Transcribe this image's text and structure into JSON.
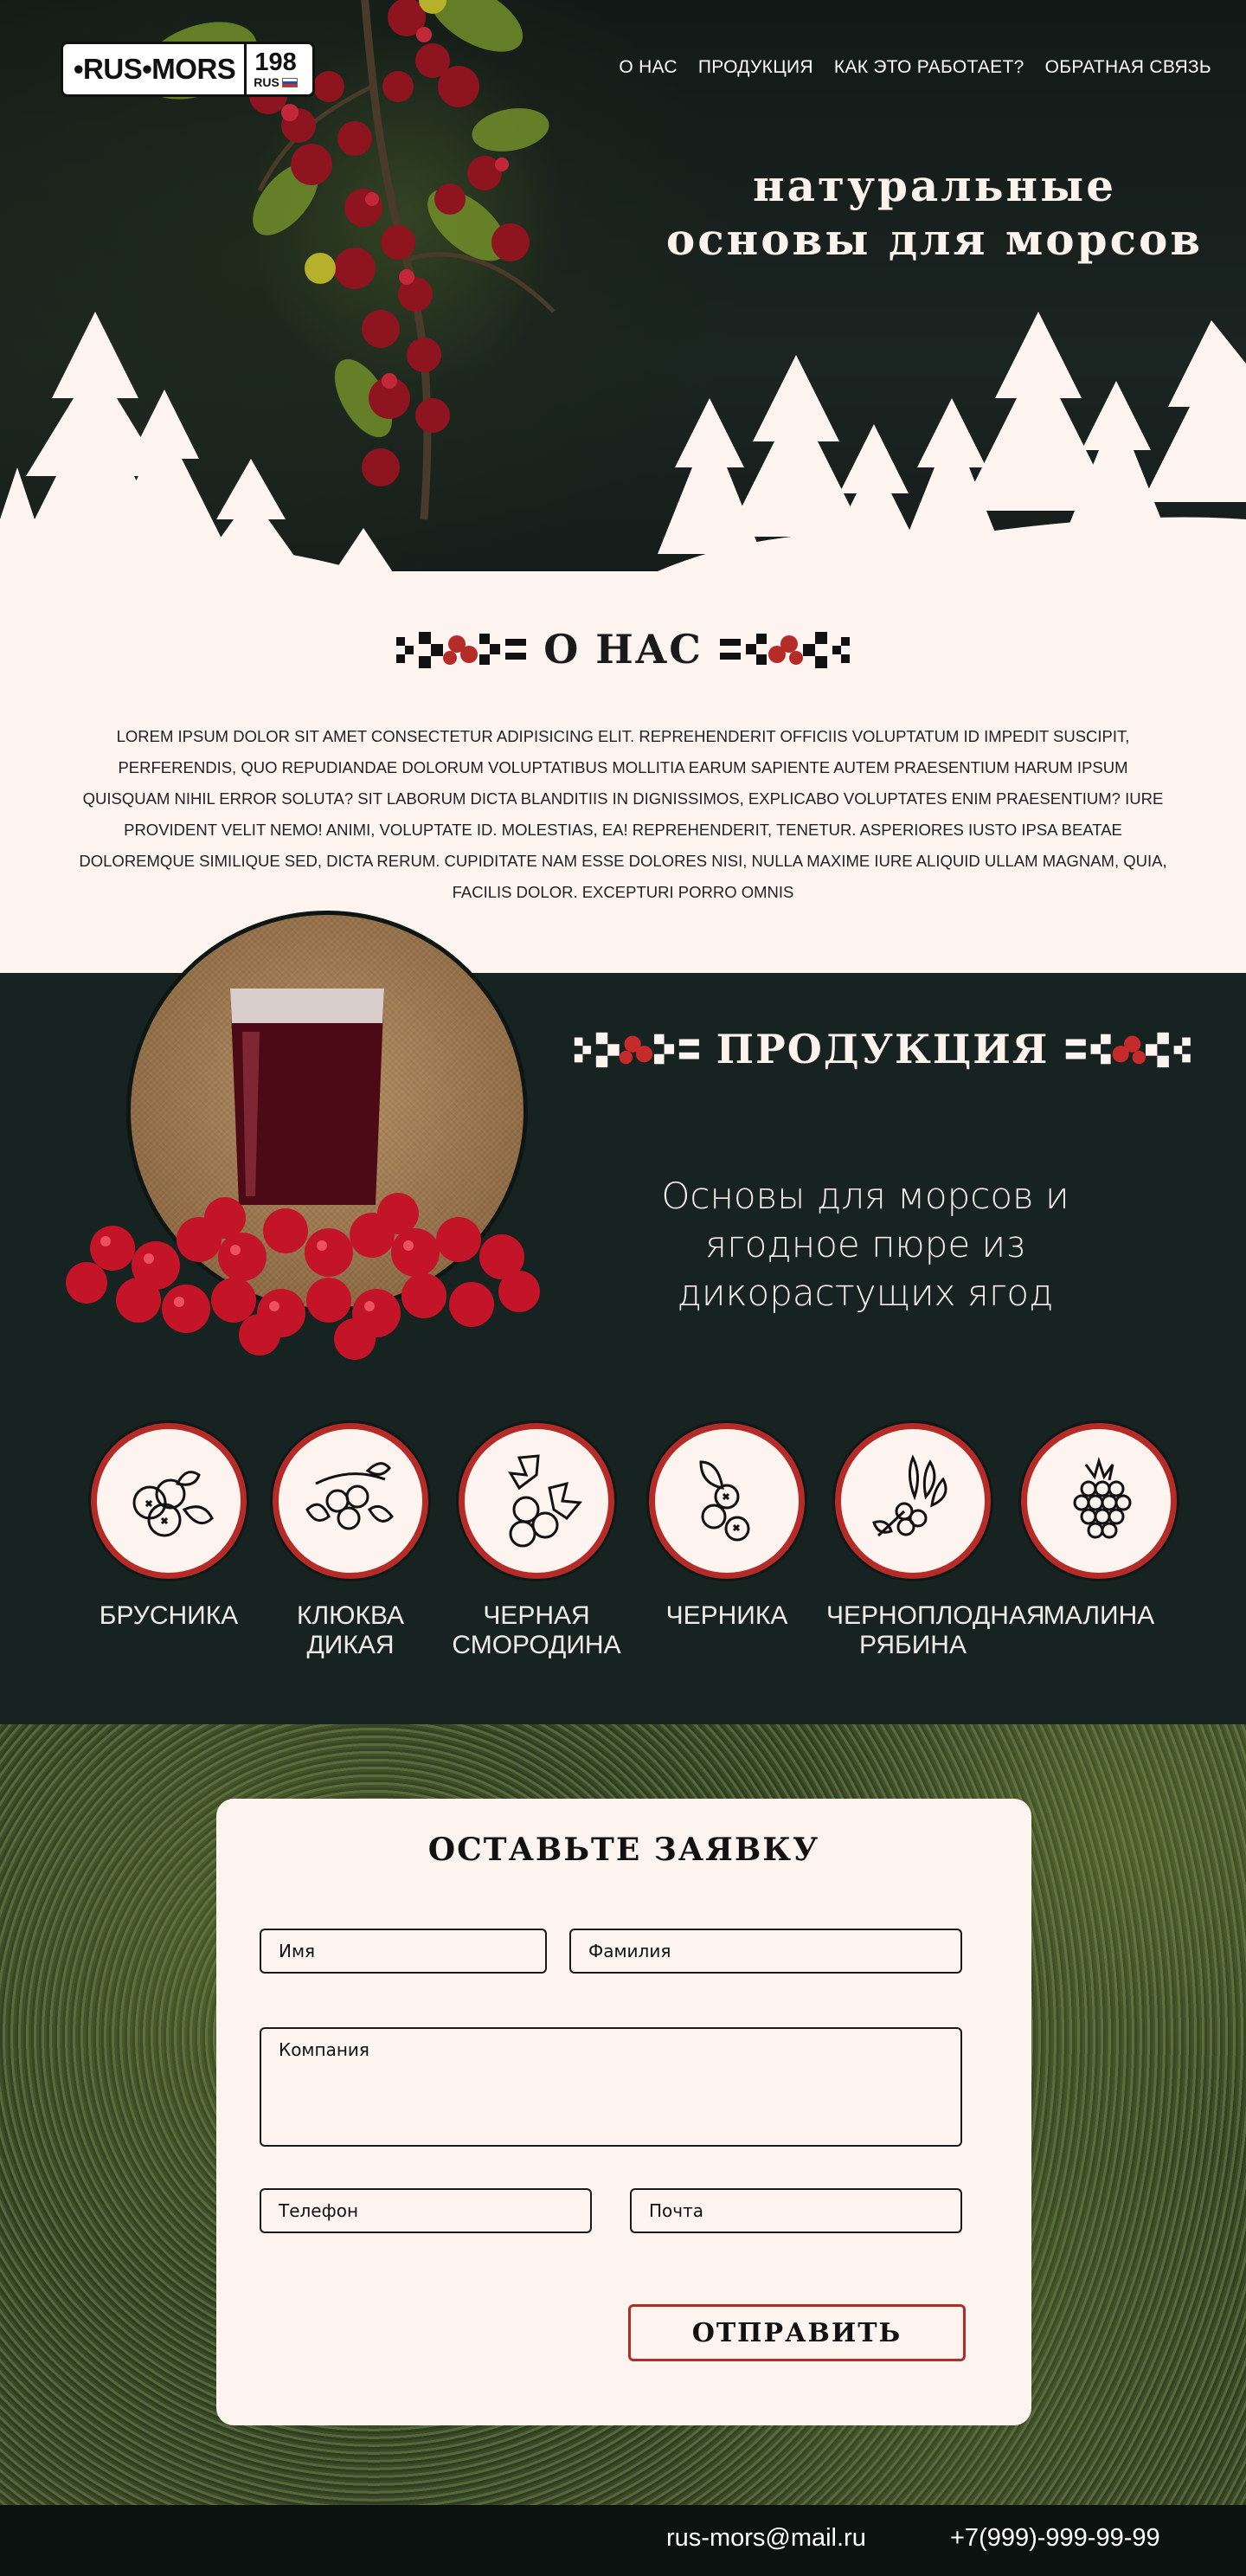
{
  "logo": {
    "brand": "•RUS•MORS",
    "region": "198",
    "country": "RUS"
  },
  "nav": {
    "items": [
      "О НАС",
      "ПРОДУКЦИЯ",
      "КАК ЭТО РАБОТАЕТ?",
      "ОБРАТНАЯ СВЯЗЬ"
    ]
  },
  "hero": {
    "title": "НАТУРАЛЬНЫЕ ОСНОВЫ ДЛЯ МОРСОВ"
  },
  "about": {
    "title": "О НАС",
    "text": "Lorem ipsum dolor sit amet consectetur adipisicing elit. Reprehenderit officiis voluptatum id impedit suscipit, perferendis, quo repudiandae dolorum voluptatibus mollitia earum sapiente autem praesentium harum ipsum quisquam nihil error soluta? Sit laborum dicta blanditiis in dignissimos, explicabo voluptates enim praesentium? Iure provident velit nemo! Animi, voluptate id. Molestias, ea! Reprehenderit, tenetur. Asperiores iusto ipsa beatae doloremque similique sed, dicta rerum. Cupiditate nam esse dolores nisi, nulla maxime iure aliquid ullam magnam, quia, facilis dolor. Excepturi porro omnis"
  },
  "products": {
    "title": "ПРОДУКЦИЯ",
    "subtitle": "Основы для морсов и ягодное пюре из дикорастущих ягод",
    "berries": [
      {
        "name": "БРУСНИКА",
        "icon": "lingonberry-icon"
      },
      {
        "name": "КЛЮКВА ДИКАЯ",
        "icon": "cranberry-icon"
      },
      {
        "name": "ЧЕРНАЯ СМОРОДИНА",
        "icon": "blackcurrant-icon"
      },
      {
        "name": "ЧЕРНИКА",
        "icon": "blueberry-icon"
      },
      {
        "name": "ЧЕРНОПЛОДНАЯ РЯБИНА",
        "icon": "chokeberry-icon"
      },
      {
        "name": "МАЛИНА",
        "icon": "raspberry-icon"
      }
    ]
  },
  "form": {
    "title": "ОСТАВЬТЕ ЗАЯВКУ",
    "first_name_placeholder": "Имя",
    "last_name_placeholder": "Фамилия",
    "company_placeholder": "Компания",
    "phone_placeholder": "Телефон",
    "email_placeholder": "Почта",
    "submit_label": "ОТПРАВИТЬ"
  },
  "footer": {
    "email": "rus-mors@mail.ru",
    "phone": "+7(999)-999-99-99"
  },
  "colors": {
    "accent": "#b52b27",
    "dark": "#172321",
    "cream": "#fdf4f0"
  }
}
